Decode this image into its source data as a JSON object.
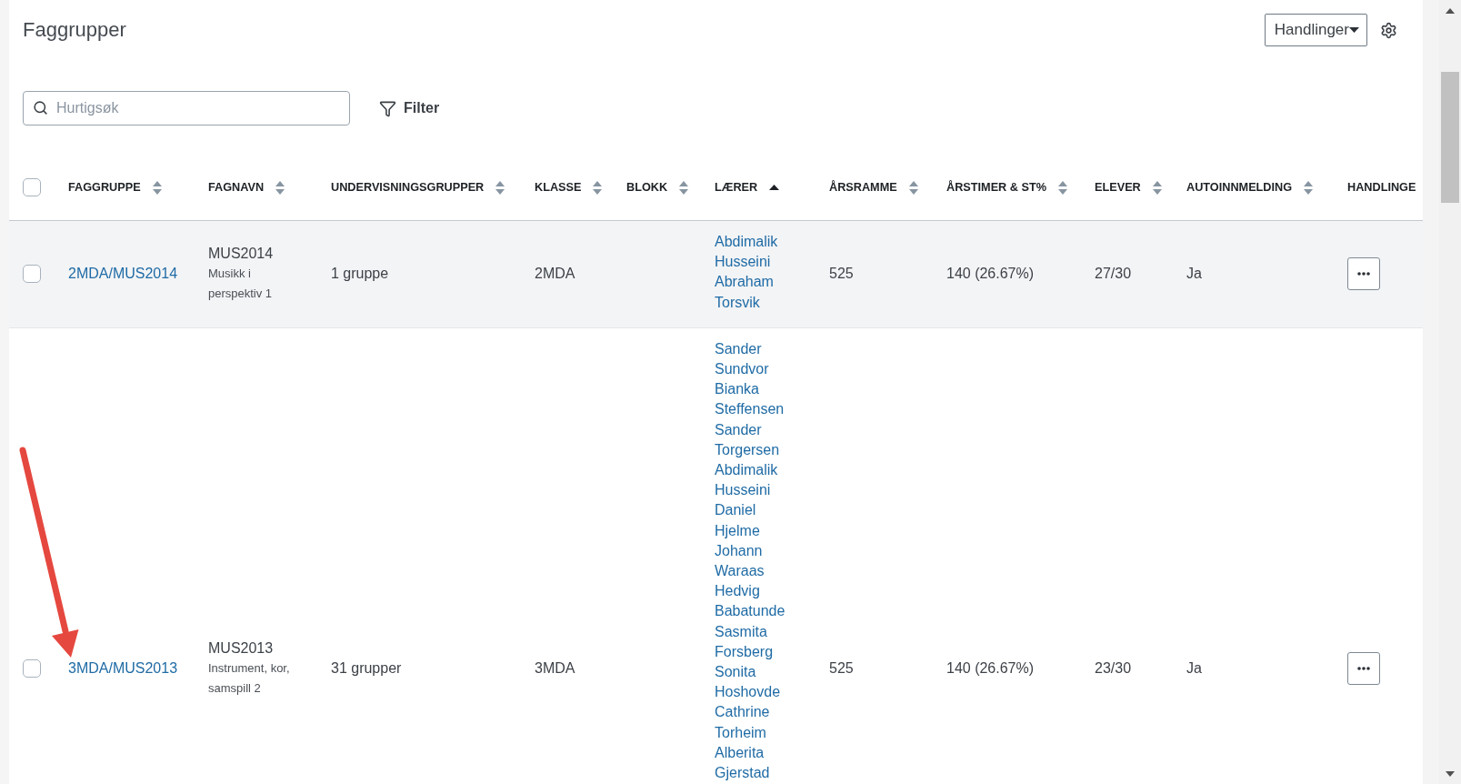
{
  "page": {
    "title": "Faggrupper"
  },
  "header_actions": {
    "actions_button": {
      "label": "Handlinger"
    }
  },
  "toolbar": {
    "search": {
      "placeholder": "Hurtigsøk"
    },
    "filter_button": {
      "label": "Filter"
    }
  },
  "table": {
    "select_all": {
      "checked": false
    },
    "columns": [
      {
        "label": "FAGGRUPPE",
        "sortable": true,
        "sorted": false
      },
      {
        "label": "FAGNAVN",
        "sortable": true,
        "sorted": false
      },
      {
        "label": "UNDERVISNINGSGRUPPER",
        "sortable": true,
        "sorted": false
      },
      {
        "label": "KLASSE",
        "sortable": true,
        "sorted": false
      },
      {
        "label": "BLOKK",
        "sortable": true,
        "sorted": false
      },
      {
        "label": "LÆRER",
        "sortable": true,
        "sorted": true,
        "ascending": true
      },
      {
        "label": "ÅRSRAMME",
        "sortable": true,
        "sorted": false
      },
      {
        "label": "ÅRSTIMER & ST%",
        "sortable": true,
        "sorted": false
      },
      {
        "label": "ELEVER",
        "sortable": true,
        "sorted": false
      },
      {
        "label": "AUTOINNMELDING",
        "sortable": true,
        "sorted": false
      },
      {
        "label": "HANDLINGE"
      }
    ],
    "rows": [
      {
        "checked": false,
        "highlighted": true,
        "faggruppe": "2MDA/MUS2014",
        "fag_code": "MUS2014",
        "fag_name": "Musikk i perspektiv 1",
        "undervisningsgrupper": "1 gruppe",
        "klasse": "2MDA",
        "teachers": [
          "Abdimalik Husseini",
          "Abraham Torsvik"
        ],
        "aarsramme": "525",
        "aarstimer": "140 (26.67%)",
        "elever": "27/30",
        "autoinnmelding": "Ja"
      },
      {
        "checked": false,
        "highlighted": false,
        "faggruppe": "3MDA/MUS2013",
        "fag_code": "MUS2013",
        "fag_name": "Instrument, kor, samspill 2",
        "undervisningsgrupper": "31 grupper",
        "klasse": "3MDA",
        "teachers": [
          "Sander Sundvor",
          "Bianka Steffensen",
          "Sander Torgersen",
          "Abdimalik Husseini",
          "Daniel Hjelme",
          "Johann Waraas",
          "Hedvig Babatunde",
          "Sasmita Forsberg",
          "Sonita Hoshovde",
          "Cathrine Torheim",
          "Alberita Gjerstad"
        ],
        "aarsramme": "525",
        "aarstimer": "140 (26.67%)",
        "elever": "23/30",
        "autoinnmelding": "Ja"
      }
    ]
  }
}
